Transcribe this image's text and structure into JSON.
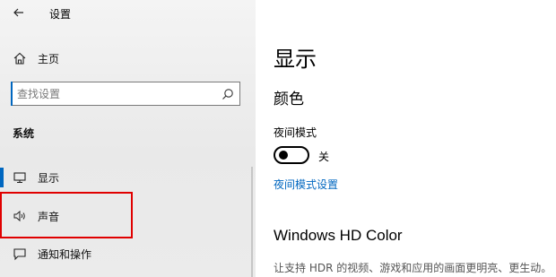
{
  "window": {
    "title": "设置"
  },
  "sidebar": {
    "home_label": "主页",
    "search": {
      "placeholder": "查找设置"
    },
    "section_label": "系统",
    "items": [
      {
        "label": "显示",
        "icon": "monitor-icon",
        "active": true
      },
      {
        "label": "声音",
        "icon": "speaker-icon",
        "active": false
      },
      {
        "label": "通知和操作",
        "icon": "notification-icon",
        "active": false
      }
    ]
  },
  "main": {
    "page_title": "显示",
    "color_section_title": "颜色",
    "night_mode": {
      "label": "夜间模式",
      "state_label": "关",
      "on": false
    },
    "night_mode_settings_link": "夜间模式设置",
    "hd_color_title": "Windows HD Color",
    "hd_color_description": "让支持 HDR 的视频、游戏和应用的画面更明亮、更生动。"
  },
  "colors": {
    "accent": "#0067c0",
    "highlight_box": "#e00000",
    "sidebar_bg": "#eeeeee"
  }
}
